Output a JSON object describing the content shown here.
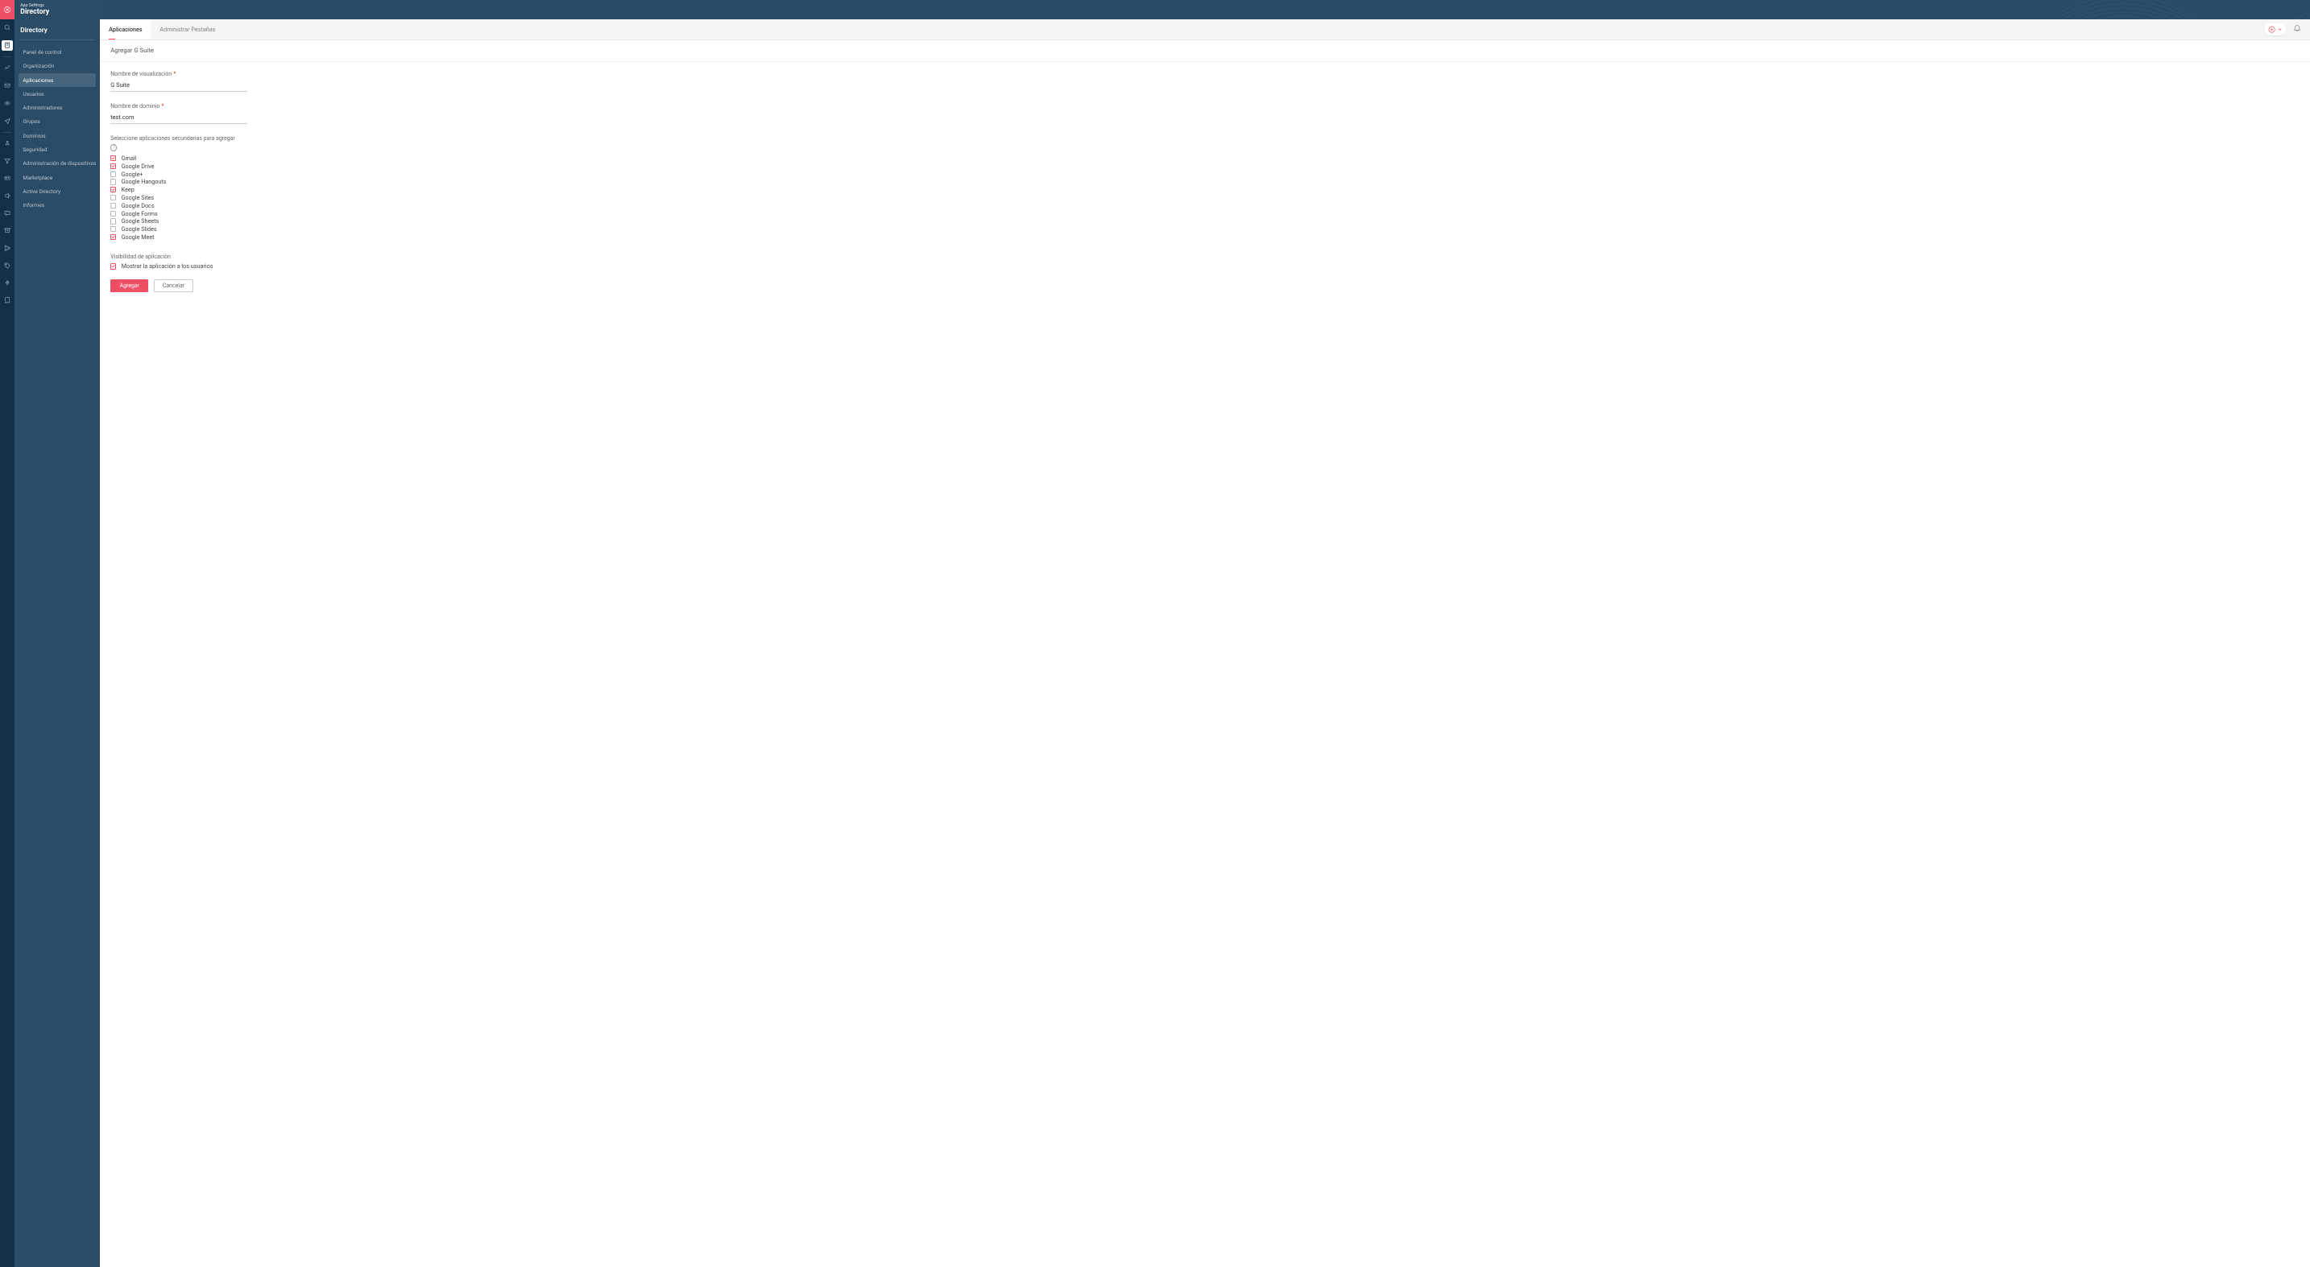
{
  "header": {
    "super": "App Settings",
    "title": "Directory"
  },
  "rail": {
    "icons": [
      "close",
      "search",
      "directory",
      "dash",
      "mail",
      "eye",
      "send",
      "div",
      "draw",
      "filter",
      "card",
      "announce",
      "chat",
      "archive",
      "flow",
      "tag",
      "bolt",
      "book"
    ]
  },
  "sidebar": {
    "section_title": "Directory",
    "items": [
      {
        "label": "Panel de control"
      },
      {
        "label": "Organización"
      },
      {
        "label": "Aplicaciones",
        "active": true
      },
      {
        "label": "Usuarios"
      },
      {
        "label": "Administradores"
      },
      {
        "label": "Grupos"
      },
      {
        "label": "Dominios"
      },
      {
        "label": "Seguridad"
      },
      {
        "label": "Administración de dispositivos"
      },
      {
        "label": "Marketplace"
      },
      {
        "label": "Active Directory"
      },
      {
        "label": "Informes"
      }
    ]
  },
  "tabs": [
    {
      "label": "Aplicaciones",
      "active": true
    },
    {
      "label": "Administrar Pestañas"
    }
  ],
  "breadcrumb": "Agregar G Suite",
  "form": {
    "display_name": {
      "label": "Nombre de visualización",
      "value": "G Suite"
    },
    "domain_name": {
      "label": "Nombre de dominio",
      "value": "test.com"
    },
    "sub_apps_label": "Seleccione aplicaciones secundarias para agregar",
    "sub_apps": [
      {
        "label": "Gmail",
        "checked": true
      },
      {
        "label": "Google Drive",
        "checked": true
      },
      {
        "label": "Google+",
        "checked": false
      },
      {
        "label": "Google Hangouts",
        "checked": false
      },
      {
        "label": "Keep",
        "checked": true
      },
      {
        "label": "Google Sites",
        "checked": false
      },
      {
        "label": "Google Docs",
        "checked": false
      },
      {
        "label": "Google Forms",
        "checked": false
      },
      {
        "label": "Google Sheets",
        "checked": false
      },
      {
        "label": "Google Slides",
        "checked": false
      },
      {
        "label": "Google Meet",
        "checked": true
      }
    ],
    "visibility": {
      "label": "Visibilidad de aplicación",
      "option": "Mostrar la aplicación a los usuarios",
      "checked": true
    },
    "buttons": {
      "primary": "Agregar",
      "secondary": "Cancelar"
    }
  }
}
